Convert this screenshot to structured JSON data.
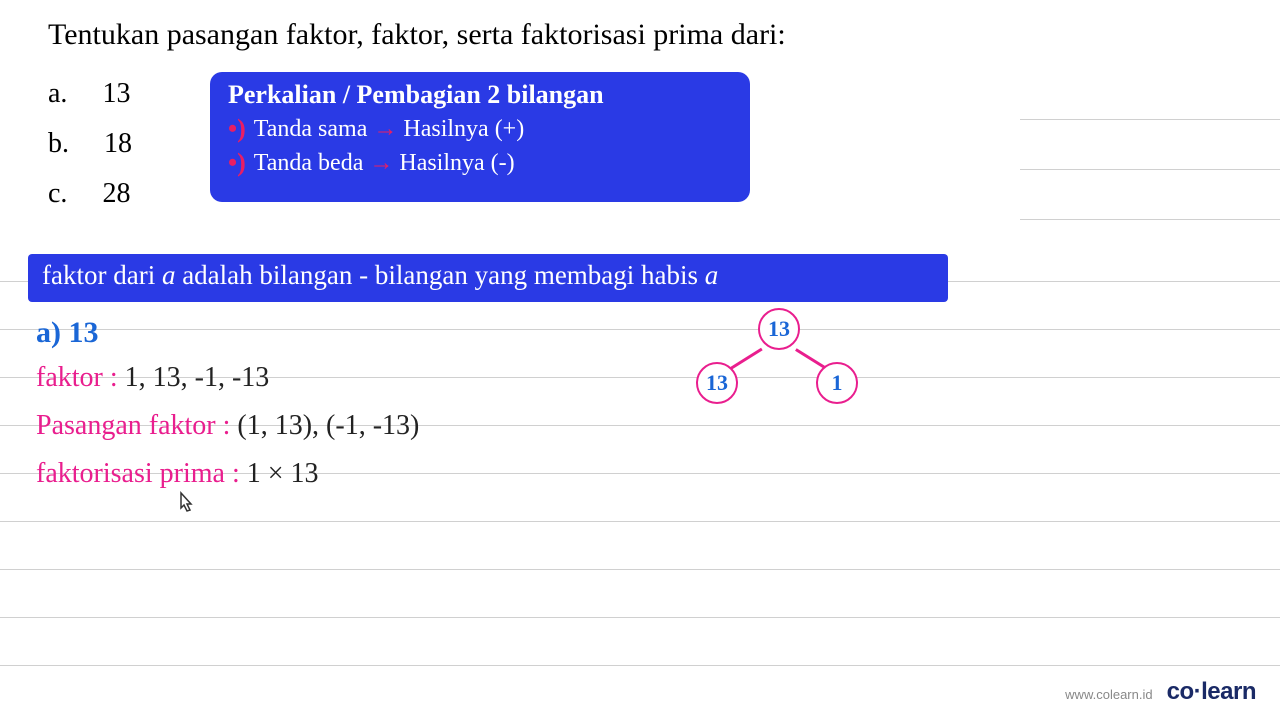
{
  "title": "Tentukan pasangan faktor, faktor, serta faktorisasi prima dari:",
  "options": {
    "a": {
      "letter": "a.",
      "num": "13"
    },
    "b": {
      "letter": "b.",
      "num": "18"
    },
    "c": {
      "letter": "c.",
      "num": "28"
    }
  },
  "blue_box": {
    "title": "Perkalian / Pembagian 2 bilangan",
    "line1_a": "Tanda sama",
    "line1_b": "Hasilnya (+)",
    "line2_a": "Tanda beda",
    "line2_b": "Hasilnya (-)"
  },
  "definition": {
    "pre": "faktor dari ",
    "var1": "a",
    "mid": " adalah bilangan - bilangan yang membagi habis ",
    "var2": "a"
  },
  "answer_a": {
    "heading": "a) 13",
    "faktor_label": "faktor :",
    "faktor_values": " 1, 13, -1, -13",
    "pasangan_label": "Pasangan faktor :",
    "pasangan_values": " (1, 13), (-1, -13)",
    "faktorisasi_label": "faktorisasi prima :",
    "faktorisasi_values": " 1 × 13"
  },
  "tree": {
    "root": "13",
    "left": "13",
    "right": "1"
  },
  "footer": {
    "url": "www.colearn.id",
    "logo_a": "co",
    "logo_dot": "·",
    "logo_b": "learn"
  }
}
